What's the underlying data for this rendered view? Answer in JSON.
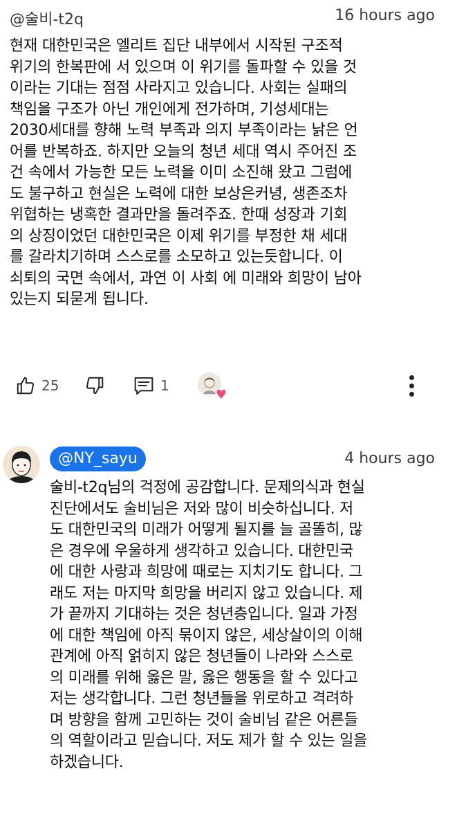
{
  "comment": {
    "author": "@술비-t2q",
    "time": "16 hours ago",
    "text": "현재 대한민국은 엘리트 집단 내부에서 시작된 구조적\n위기의 한복판에 서 있으며 이 위기를 돌파할 수 있을 것\n이라는 기대는 점점 사라지고 있습니다. 사회는 실패의\n책임을 구조가 아닌 개인에게 전가하며, 기성세대는\n2030세대를 향해 노력 부족과 의지 부족이라는 낡은 언\n어를 반복하죠. 하지만 오늘의 청년 세대 역시 주어진 조\n건 속에서 가능한 모든 노력을 이미 소진해 왔고 그럼에\n도 불구하고 현실은 노력에 대한 보상은커녕, 생존조차\n위협하는 냉혹한 결과만을 돌려주죠. 한때 성장과 기회\n의 상징이었던 대한민국은 이제 위기를 부정한 채 세대\n를 갈라치기하며 스스로를 소모하고 있는듯합니다. 이\n쇠퇴의 국면 속에서, 과연 이 사회 에 미래와 희망이 남아\n있는지 되묻게 됩니다.",
    "likes": "25",
    "replies": "1",
    "icons": {
      "like": "thumbs-up-icon",
      "dislike": "thumbs-down-icon",
      "reply": "comment-icon",
      "hearted": "heart-icon",
      "more": "more-vertical-icon"
    }
  },
  "reply": {
    "author": "@NY_sayu",
    "time": "4 hours ago",
    "text": "술비-t2q님의 걱정에 공감합니다. 문제의식과 현실\n진단에서도 술비님은 저와 많이 비슷하십니다. 저\n도 대한민국의 미래가 어떻게 될지를 늘 골똘히, 많\n은 경우에 우울하게 생각하고 있습니다. 대한민국\n에 대한 사랑과 희망에 때로는 지치기도 합니다. 그\n래도 저는 마지막 희망을 버리지 않고 있습니다. 제\n가 끝까지 기대하는 것은 청년층입니다. 일과 가정\n에 대한 책임에 아직 묶이지 않은, 세상살이의 이해\n관계에 아직 얽히지 않은 청년들이 나라와 스스로\n의 미래를 위해 옳은 말, 옳은 행동을 할 수 있다고\n저는 생각합니다. 그런 청년들을 위로하고 격려하\n며 방향을 함께 고민하는 것이 술비님 같은 어른들\n의 역할이라고 믿습니다. 저도 제가 할 수 있는 일을\n하겠습니다."
  },
  "colors": {
    "author_badge": "#1a73e8",
    "heart": "#ef4b7c"
  }
}
